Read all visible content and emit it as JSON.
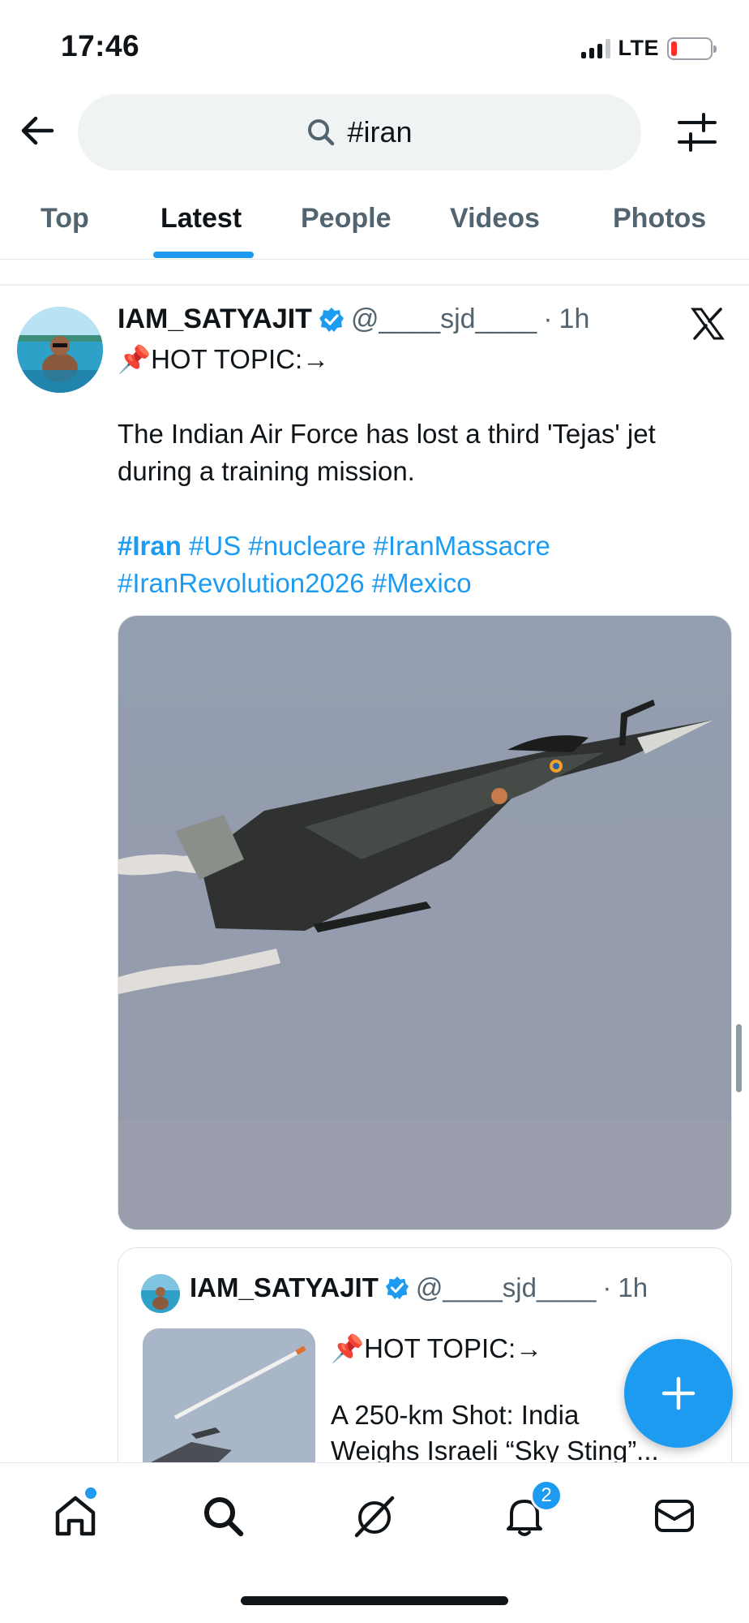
{
  "status_bar": {
    "time": "17:46",
    "network": "LTE",
    "battery_level": 0.15
  },
  "search": {
    "query": "#iran",
    "icons": [
      "back-arrow-icon",
      "search-icon",
      "filter-sliders-icon"
    ]
  },
  "tabs": [
    {
      "label": "Top",
      "active": false
    },
    {
      "label": "Latest",
      "active": true
    },
    {
      "label": "People",
      "active": false
    },
    {
      "label": "Videos",
      "active": false
    },
    {
      "label": "Photos",
      "active": false
    }
  ],
  "tweet": {
    "author_name": "IAM_SATYAJIT",
    "handle": "@____sjd____",
    "separator": "·",
    "time": "1h",
    "verified": true,
    "text_lines": [
      "📌HOT TOPIC:→",
      "The Indian Air Force has lost a third 'Tejas' jet",
      "during a training mission."
    ],
    "hashtags_line1": [
      "#Iran",
      "#US",
      "#nucleare",
      "#IranMassacre"
    ],
    "hashtags_line2": [
      "#IranRevolution2026",
      "#Mexico"
    ],
    "media_icon": "fighter-jet-photo"
  },
  "quote_tweet": {
    "author_name": "IAM_SATYAJIT",
    "handle": "@____sjd____",
    "separator": "·",
    "time": "1h",
    "text_lines": [
      "📌HOT TOPIC:→",
      "A 250-km Shot: India",
      "Weighs Israeli “Sky Sting”..."
    ]
  },
  "fab": {
    "icon": "plus-icon"
  },
  "bottom_nav": {
    "items": [
      "home-icon",
      "search-icon",
      "grok-icon",
      "bell-icon",
      "mail-icon"
    ],
    "notifications_count": "2"
  },
  "colors": {
    "accent": "#1d9bf0",
    "text": "#0f1419",
    "secondary": "#536471"
  }
}
